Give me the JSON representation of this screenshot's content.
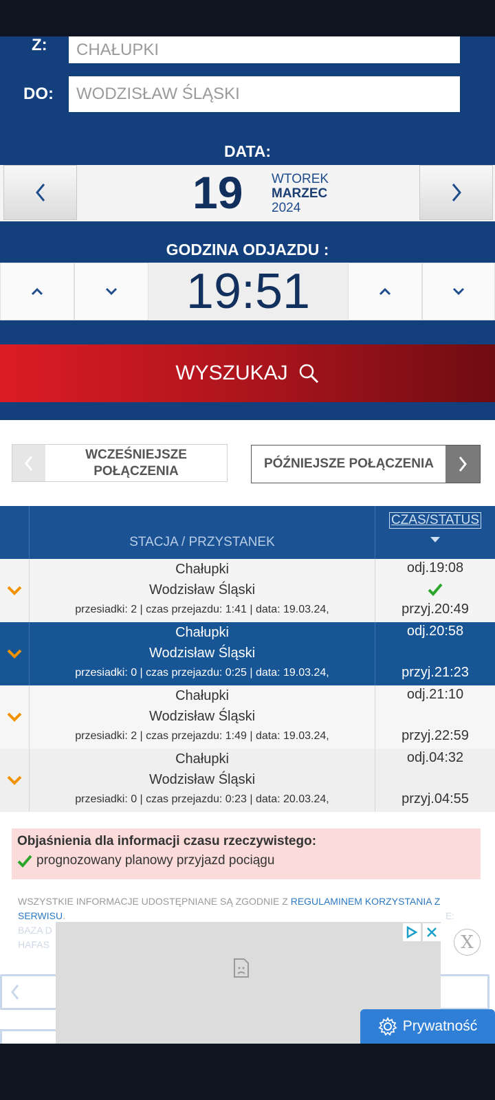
{
  "form": {
    "from_label": "Z:",
    "from_value": "CHAŁUPKI",
    "to_label": "DO:",
    "to_value": "WODZISŁAW ŚLĄSKI",
    "date_title": "DATA:",
    "date_day": "19",
    "date_weekday": "WTOREK",
    "date_month": "MARZEC",
    "date_year": "2024",
    "time_title": "GODZINA ODJAZDU :",
    "time_value": "19:51",
    "search_label": "WYSZUKAJ"
  },
  "pager": {
    "earlier": "WCZEŚNIEJSZE POŁĄCZENIA",
    "later": "PÓŹNIEJSZE POŁĄCZENIA"
  },
  "table": {
    "col_station": "STACJA / PRZYSTANEK",
    "col_time": "CZAS/STATUS",
    "rows": [
      {
        "from": "Chałupki",
        "to": "Wodzisław Śląski",
        "meta": "przesiadki: 2 | czas przejazdu: 1:41 | data: 19.03.24,",
        "dep": "odj.19:08",
        "arr": "przyj.20:49",
        "check": true
      },
      {
        "from": "Chałupki",
        "to": "Wodzisław Śląski",
        "meta": "przesiadki: 0 | czas przejazdu: 0:25 | data: 19.03.24,",
        "dep": "odj.20:58",
        "arr": "przyj.21:23",
        "check": false
      },
      {
        "from": "Chałupki",
        "to": "Wodzisław Śląski",
        "meta": "przesiadki: 2 | czas przejazdu: 1:49 | data: 19.03.24,",
        "dep": "odj.21:10",
        "arr": "przyj.22:59",
        "check": false
      },
      {
        "from": "Chałupki",
        "to": "Wodzisław Śląski",
        "meta": "przesiadki: 0 | czas przejazdu: 0:23 | data: 20.03.24,",
        "dep": "odj.04:32",
        "arr": "przyj.04:55",
        "check": false
      }
    ]
  },
  "legend": {
    "title": "Objaśnienia dla informacji czasu rzeczywistego:",
    "item": "prognozowany planowy przyjazd pociągu"
  },
  "footer": {
    "text": "WSZYSTKIE INFORMACJE UDOSTĘPNIANE SĄ ZGODNIE Z",
    "link": "REGULAMINEM KORZYSTANIA Z SERWISU",
    "faded_left_1": "BAZA D",
    "faded_left_2": "HAFAS",
    "faded_right": "E:"
  },
  "ad": {
    "close": "X"
  },
  "privacy": "Prywatność",
  "colors": {
    "brand_blue": "#133f7d",
    "search_red": "#dc1c24",
    "accent_orange": "#f39200",
    "check_green": "#2aa62a"
  }
}
